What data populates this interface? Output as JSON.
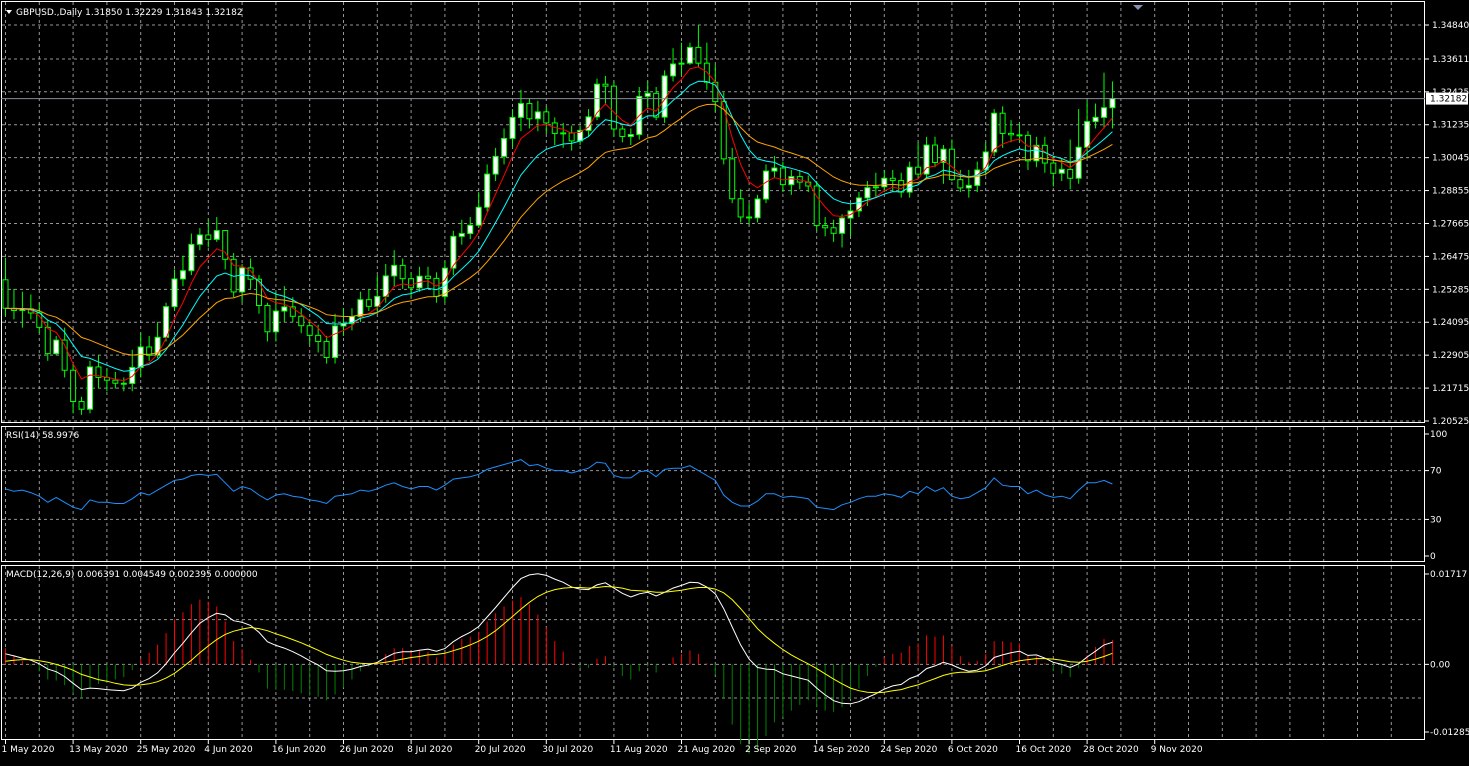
{
  "main": {
    "title": "GBPUSD.,Daily  1.31850 1.32229 1.31843 1.32182",
    "last_price_label": "1.32182",
    "yticks": [
      "1.34840",
      "1.33611",
      "1.32425",
      "1.31235",
      "1.30045",
      "1.28855",
      "1.27665",
      "1.26475",
      "1.25285",
      "1.24095",
      "1.22905",
      "1.21715",
      "1.20525"
    ]
  },
  "rsi": {
    "title": "RSI(14) 58.9976",
    "yticks": [
      "100",
      "70",
      "30",
      "0"
    ]
  },
  "macd": {
    "title": "MACD(12,26,9) 0.006391 0.004549 0.002395 0.000000",
    "yticks": [
      "0.01717",
      "0.00",
      "-0.01285"
    ]
  },
  "xaxis": {
    "labels": [
      "1 May 2020",
      "13 May 2020",
      "25 May 2020",
      "4 Jun 2020",
      "16 Jun 2020",
      "26 Jun 2020",
      "8 Jul 2020",
      "20 Jul 2020",
      "30 Jul 2020",
      "11 Aug 2020",
      "21 Aug 2020",
      "2 Sep 2020",
      "14 Sep 2020",
      "24 Sep 2020",
      "6 Oct 2020",
      "16 Oct 2020",
      "28 Oct 2020",
      "9 Nov 2020"
    ]
  },
  "colors": {
    "background": "#000000",
    "bull_candle": "#ffffff",
    "bear_candle": "#000000",
    "candle_wick": "#00ff00",
    "ma_fast": "#ff0000",
    "ma_mid": "#00ffff",
    "ma_slow": "#ffa500",
    "rsi_line": "#1e90ff",
    "macd_line": "#ffffff",
    "signal_line": "#ffff00",
    "hist_positive": "#ff0000",
    "hist_negative": "#008000"
  },
  "chart_data": [
    {
      "type": "candlestick",
      "title": "GBPUSD.,Daily",
      "ylim": [
        1.20525,
        1.3484
      ],
      "grid": true,
      "open": [
        1.2563,
        1.246,
        1.2452,
        1.2458,
        1.2443,
        1.2391,
        1.2296,
        1.2345,
        1.2236,
        1.2123,
        1.2095,
        1.2248,
        1.221,
        1.22,
        1.2189,
        1.2188,
        1.2246,
        1.232,
        1.229,
        1.2355,
        1.2466,
        1.2566,
        1.2596,
        1.2691,
        1.2725,
        1.2709,
        1.2741,
        1.2637,
        1.2519,
        1.2606,
        1.2565,
        1.247,
        1.2375,
        1.245,
        1.2465,
        1.2431,
        1.2397,
        1.2362,
        1.234,
        1.2282,
        1.2396,
        1.2405,
        1.243,
        1.2491,
        1.2467,
        1.2503,
        1.2577,
        1.2615,
        1.2567,
        1.2534,
        1.2576,
        1.2568,
        1.2503,
        1.2605,
        1.272,
        1.273,
        1.276,
        1.2825,
        1.2945,
        1.3009,
        1.3074,
        1.315,
        1.32,
        1.3145,
        1.317,
        1.313,
        1.3092,
        1.3094,
        1.3065,
        1.3103,
        1.3152,
        1.327,
        1.3263,
        1.3108,
        1.3081,
        1.3088,
        1.3226,
        1.3237,
        1.3151,
        1.33,
        1.3343,
        1.3346,
        1.3403,
        1.3346,
        1.3277,
        1.3207,
        1.3,
        1.2856,
        1.279,
        1.2787,
        1.2855,
        1.2956,
        1.2967,
        1.2907,
        1.2936,
        1.2916,
        1.2902,
        1.2759,
        1.2751,
        1.2731,
        1.2786,
        1.2812,
        1.2859,
        1.2896,
        1.2899,
        1.293,
        1.2922,
        1.288,
        1.297,
        1.2945,
        1.305,
        1.2987,
        1.3035,
        1.2925,
        1.2895,
        1.2904,
        1.296,
        1.3025,
        1.3165,
        1.3092,
        1.3087,
        1.3085,
        1.2993,
        1.3049,
        1.2985,
        1.2948,
        1.2962,
        1.293,
        1.3042,
        1.3135,
        1.315,
        1.3185
      ],
      "high": [
        1.2642,
        1.253,
        1.252,
        1.251,
        1.248,
        1.242,
        1.236,
        1.239,
        1.226,
        1.214,
        1.227,
        1.229,
        1.224,
        1.223,
        1.221,
        1.231,
        1.237,
        1.236,
        1.241,
        1.248,
        1.26,
        1.265,
        1.273,
        1.275,
        1.278,
        1.279,
        1.274,
        1.266,
        1.262,
        1.264,
        1.258,
        1.248,
        1.252,
        1.254,
        1.25,
        1.246,
        1.242,
        1.24,
        1.236,
        1.244,
        1.246,
        1.246,
        1.252,
        1.253,
        1.258,
        1.262,
        1.267,
        1.264,
        1.259,
        1.261,
        1.261,
        1.259,
        1.263,
        1.274,
        1.278,
        1.279,
        1.288,
        1.298,
        1.304,
        1.311,
        1.318,
        1.325,
        1.322,
        1.321,
        1.319,
        1.315,
        1.313,
        1.312,
        1.312,
        1.318,
        1.329,
        1.33,
        1.328,
        1.312,
        1.311,
        1.326,
        1.328,
        1.326,
        1.332,
        1.34,
        1.342,
        1.342,
        1.3484,
        1.342,
        1.334,
        1.324,
        1.304,
        1.289,
        1.284,
        1.287,
        1.298,
        1.301,
        1.299,
        1.296,
        1.296,
        1.294,
        1.292,
        1.279,
        1.278,
        1.28,
        1.284,
        1.288,
        1.292,
        1.295,
        1.296,
        1.296,
        1.295,
        1.299,
        1.306,
        1.308,
        1.308,
        1.305,
        1.307,
        1.296,
        1.296,
        1.299,
        1.306,
        1.318,
        1.319,
        1.314,
        1.313,
        1.31,
        1.308,
        1.308,
        1.301,
        1.3,
        1.307,
        1.318,
        1.321,
        1.32,
        1.3312,
        1.328,
        1.3223
      ],
      "low": [
        1.243,
        1.242,
        1.239,
        1.242,
        1.237,
        1.227,
        1.229,
        1.221,
        1.208,
        1.2075,
        1.208,
        1.217,
        1.216,
        1.217,
        1.216,
        1.216,
        1.221,
        1.227,
        1.228,
        1.234,
        1.245,
        1.254,
        1.258,
        1.267,
        1.268,
        1.27,
        1.26,
        1.25,
        1.248,
        1.253,
        1.244,
        1.234,
        1.234,
        1.241,
        1.241,
        1.237,
        1.233,
        1.23,
        1.226,
        1.226,
        1.236,
        1.238,
        1.241,
        1.245,
        1.244,
        1.248,
        1.254,
        1.253,
        1.25,
        1.252,
        1.253,
        1.248,
        1.248,
        1.258,
        1.269,
        1.271,
        1.275,
        1.281,
        1.292,
        1.298,
        1.304,
        1.31,
        1.311,
        1.31,
        1.309,
        1.305,
        1.304,
        1.303,
        1.305,
        1.308,
        1.314,
        1.32,
        1.308,
        1.306,
        1.305,
        1.307,
        1.318,
        1.314,
        1.313,
        1.328,
        1.33,
        1.334,
        1.333,
        1.325,
        1.317,
        1.298,
        1.284,
        1.277,
        1.276,
        1.277,
        1.284,
        1.293,
        1.288,
        1.287,
        1.289,
        1.288,
        1.274,
        1.272,
        1.27,
        1.268,
        1.272,
        1.279,
        1.283,
        1.286,
        1.288,
        1.288,
        1.286,
        1.286,
        1.293,
        1.293,
        1.297,
        1.291,
        1.292,
        1.288,
        1.286,
        1.288,
        1.294,
        1.301,
        1.304,
        1.306,
        1.306,
        1.296,
        1.297,
        1.295,
        1.29,
        1.292,
        1.289,
        1.291,
        1.3,
        1.311,
        1.311,
        1.311,
        1.315
      ],
      "close": [
        1.246,
        1.2452,
        1.2458,
        1.2443,
        1.2391,
        1.2296,
        1.2345,
        1.2236,
        1.2123,
        1.2095,
        1.2248,
        1.221,
        1.22,
        1.2189,
        1.2188,
        1.2246,
        1.232,
        1.229,
        1.2355,
        1.2466,
        1.2566,
        1.2596,
        1.2691,
        1.2725,
        1.2709,
        1.2741,
        1.2637,
        1.2519,
        1.2606,
        1.2565,
        1.247,
        1.2375,
        1.245,
        1.2465,
        1.2431,
        1.2397,
        1.2362,
        1.234,
        1.2282,
        1.2396,
        1.2405,
        1.243,
        1.2491,
        1.2467,
        1.2503,
        1.2577,
        1.2615,
        1.2567,
        1.2534,
        1.2576,
        1.2568,
        1.2503,
        1.2605,
        1.272,
        1.273,
        1.276,
        1.2825,
        1.2945,
        1.3009,
        1.3074,
        1.315,
        1.32,
        1.3145,
        1.317,
        1.313,
        1.3092,
        1.3094,
        1.3065,
        1.3103,
        1.3152,
        1.327,
        1.3263,
        1.3108,
        1.3081,
        1.3088,
        1.3226,
        1.3237,
        1.3151,
        1.33,
        1.3343,
        1.3346,
        1.3403,
        1.3346,
        1.3277,
        1.3207,
        1.3,
        1.2856,
        1.279,
        1.2787,
        1.2855,
        1.2956,
        1.2967,
        1.2907,
        1.2936,
        1.2916,
        1.2902,
        1.2759,
        1.2751,
        1.2731,
        1.2786,
        1.2812,
        1.2859,
        1.2896,
        1.2899,
        1.293,
        1.2922,
        1.288,
        1.297,
        1.2945,
        1.305,
        1.2987,
        1.3035,
        1.2925,
        1.2895,
        1.2904,
        1.296,
        1.3025,
        1.3165,
        1.3092,
        1.3087,
        1.3085,
        1.2993,
        1.3049,
        1.2985,
        1.2948,
        1.2962,
        1.293,
        1.3042,
        1.3135,
        1.315,
        1.3185,
        1.3218
      ]
    },
    {
      "type": "line",
      "title": "RSI(14) 58.9976",
      "ylim": [
        0,
        100
      ],
      "levels": [
        70,
        30
      ],
      "values": [
        55,
        53,
        54,
        52,
        49,
        44,
        48,
        44,
        40,
        38,
        46,
        44,
        44,
        43,
        43,
        47,
        52,
        50,
        54,
        58,
        62,
        63,
        66,
        67,
        66,
        67,
        60,
        53,
        57,
        55,
        50,
        46,
        50,
        51,
        49,
        48,
        46,
        45,
        43,
        49,
        50,
        51,
        54,
        53,
        55,
        58,
        60,
        57,
        55,
        57,
        57,
        54,
        58,
        63,
        64,
        65,
        67,
        71,
        73,
        75,
        77,
        79,
        74,
        75,
        72,
        70,
        70,
        68,
        70,
        72,
        77,
        76,
        66,
        64,
        64,
        69,
        70,
        65,
        71,
        72,
        72,
        74,
        70,
        66,
        62,
        50,
        44,
        41,
        41,
        45,
        51,
        51,
        48,
        49,
        48,
        47,
        40,
        39,
        38,
        42,
        44,
        47,
        49,
        49,
        51,
        50,
        48,
        53,
        51,
        57,
        53,
        56,
        49,
        47,
        48,
        52,
        56,
        64,
        58,
        57,
        57,
        51,
        54,
        50,
        48,
        49,
        47,
        54,
        60,
        60,
        62,
        59
      ]
    },
    {
      "type": "bar",
      "title": "MACD(12,26,9) 0.006391 0.004549 0.002395 0.000000",
      "ylim": [
        -0.01285,
        0.01717
      ],
      "macd": [
        0.002,
        0.0016,
        0.0012,
        0.0008,
        0.0001,
        -0.0009,
        -0.0014,
        -0.0023,
        -0.0036,
        -0.0048,
        -0.0045,
        -0.0046,
        -0.0048,
        -0.0049,
        -0.005,
        -0.0045,
        -0.0034,
        -0.0027,
        -0.0016,
        0.0001,
        0.0022,
        0.004,
        0.006,
        0.0078,
        0.0089,
        0.0097,
        0.0094,
        0.0083,
        0.008,
        0.0074,
        0.0061,
        0.0043,
        0.0036,
        0.0031,
        0.0024,
        0.0016,
        0.0007,
        -0.0001,
        -0.0012,
        -0.0013,
        -0.0012,
        -0.0009,
        -0.0004,
        -0.0001,
        0.0004,
        0.0013,
        0.0021,
        0.0024,
        0.0024,
        0.0027,
        0.0029,
        0.0025,
        0.003,
        0.0043,
        0.0053,
        0.0061,
        0.0072,
        0.009,
        0.0108,
        0.0127,
        0.0146,
        0.0163,
        0.017,
        0.0172,
        0.0169,
        0.0162,
        0.0156,
        0.0147,
        0.0143,
        0.0142,
        0.0151,
        0.0155,
        0.0145,
        0.0135,
        0.0128,
        0.0134,
        0.0137,
        0.013,
        0.0137,
        0.0145,
        0.015,
        0.0156,
        0.0155,
        0.0147,
        0.0134,
        0.0106,
        0.0071,
        0.0037,
        0.001,
        -0.0006,
        -0.0009,
        -0.001,
        -0.0018,
        -0.0022,
        -0.0026,
        -0.003,
        -0.0045,
        -0.0058,
        -0.0069,
        -0.0074,
        -0.0075,
        -0.0071,
        -0.0063,
        -0.0056,
        -0.0047,
        -0.0041,
        -0.0038,
        -0.0027,
        -0.0021,
        -0.0008,
        -0.0003,
        0.0004,
        -0.0001,
        -0.0008,
        -0.0013,
        -0.0011,
        -0.0003,
        0.0013,
        0.0018,
        0.0022,
        0.0025,
        0.0017,
        0.0018,
        0.0012,
        0.0004,
        0.0,
        -0.0006,
        0.0001,
        0.0014,
        0.0025,
        0.0037,
        0.0042
      ],
      "signal": [
        0.0006,
        0.0008,
        0.0009,
        0.0009,
        0.0007,
        0.0004,
        0.0,
        -0.0005,
        -0.0011,
        -0.0019,
        -0.0024,
        -0.0029,
        -0.0032,
        -0.0036,
        -0.0039,
        -0.004,
        -0.0039,
        -0.0037,
        -0.0033,
        -0.0026,
        -0.0017,
        -0.0005,
        0.0008,
        0.0022,
        0.0035,
        0.0047,
        0.0057,
        0.0063,
        0.0067,
        0.007,
        0.0068,
        0.0064,
        0.0058,
        0.0053,
        0.0047,
        0.0041,
        0.0034,
        0.0027,
        0.0019,
        0.0013,
        0.0008,
        0.0004,
        0.0002,
        0.0001,
        0.0002,
        0.0004,
        0.0007,
        0.001,
        0.0013,
        0.0015,
        0.0018,
        0.0019,
        0.0021,
        0.0026,
        0.0031,
        0.0037,
        0.0044,
        0.0053,
        0.0064,
        0.0077,
        0.0091,
        0.0105,
        0.0118,
        0.0129,
        0.0137,
        0.0142,
        0.0145,
        0.0146,
        0.0146,
        0.0145,
        0.0146,
        0.0148,
        0.0147,
        0.0145,
        0.0141,
        0.014,
        0.0139,
        0.0137,
        0.0137,
        0.0139,
        0.0141,
        0.0144,
        0.0146,
        0.0146,
        0.0143,
        0.0136,
        0.0123,
        0.0106,
        0.0087,
        0.0068,
        0.0053,
        0.004,
        0.0028,
        0.0018,
        0.0009,
        0.0001,
        -0.0008,
        -0.0018,
        -0.0028,
        -0.0037,
        -0.0045,
        -0.005,
        -0.0053,
        -0.0054,
        -0.0053,
        -0.005,
        -0.0048,
        -0.0043,
        -0.0039,
        -0.0033,
        -0.0027,
        -0.0021,
        -0.0017,
        -0.0015,
        -0.0015,
        -0.0014,
        -0.0012,
        -0.0007,
        -0.0002,
        0.0003,
        0.0007,
        0.0009,
        0.0011,
        0.0011,
        0.001,
        0.0008,
        0.0005,
        0.0004,
        0.0006,
        0.001,
        0.0015,
        0.0021
      ]
    }
  ]
}
